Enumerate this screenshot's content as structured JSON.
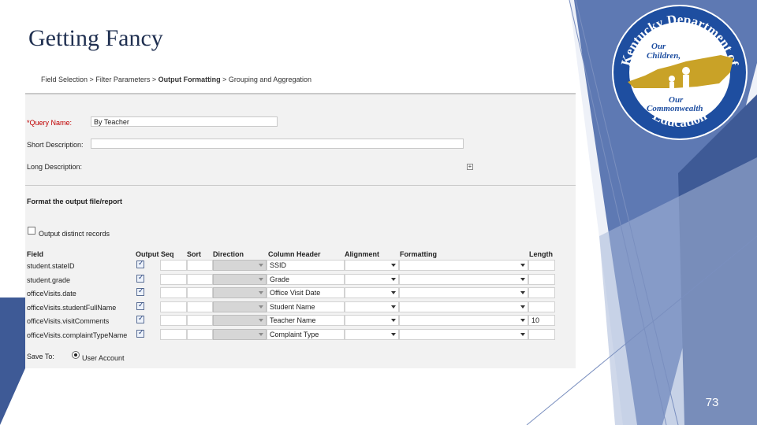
{
  "slide": {
    "title": "Getting Fancy",
    "page_number": "73",
    "colors": {
      "title": "#1f2f50",
      "accent_blue": "#5e79b3",
      "dark_blue": "#3e5a96",
      "gold": "#c9a227"
    }
  },
  "logo": {
    "seal_text_top": "Kentucky Department of",
    "seal_text_bottom": "Education",
    "center_text": [
      "Our",
      "Children,",
      "Our",
      "Commonwealth"
    ]
  },
  "screen": {
    "breadcrumbs": {
      "step1": "Field Selection >",
      "step2": "Filter Parameters >",
      "step3": "Output Formatting",
      "sep": ">",
      "step4": "Grouping and Aggregation"
    },
    "query_name": {
      "required_mark": "*",
      "label": "Query Name:",
      "value": "By Teacher"
    },
    "short_description": {
      "label": "Short Description:",
      "value": ""
    },
    "long_description": {
      "label": "Long Description:",
      "expand_symbol": "+"
    },
    "format_section": {
      "title": "Format the output file/report",
      "distinct_label": "Output distinct records",
      "distinct_checked": false
    },
    "columns": {
      "field": "Field",
      "output": "Output",
      "seq": "Seq",
      "sort": "Sort",
      "direction": "Direction",
      "column_header": "Column Header",
      "alignment": "Alignment",
      "formatting": "Formatting",
      "length": "Length"
    },
    "rows": [
      {
        "field": "student.stateID",
        "output": true,
        "seq": "",
        "sort": "",
        "direction": "",
        "header": "SSID",
        "alignment": "",
        "formatting": "",
        "length": ""
      },
      {
        "field": "student.grade",
        "output": true,
        "seq": "",
        "sort": "",
        "direction": "",
        "header": "Grade",
        "alignment": "",
        "formatting": "",
        "length": ""
      },
      {
        "field": "officeVisits.date",
        "output": true,
        "seq": "",
        "sort": "",
        "direction": "",
        "header": "Office Visit Date",
        "alignment": "",
        "formatting": "",
        "length": ""
      },
      {
        "field": "officeVisits.studentFullName",
        "output": true,
        "seq": "",
        "sort": "",
        "direction": "",
        "header": "Student Name",
        "alignment": "",
        "formatting": "",
        "length": ""
      },
      {
        "field": "officeVisits.visitComments",
        "output": true,
        "seq": "",
        "sort": "",
        "direction": "",
        "header": "Teacher Name",
        "alignment": "",
        "formatting": "",
        "length": "10"
      },
      {
        "field": "officeVisits.complaintTypeName",
        "output": true,
        "seq": "",
        "sort": "",
        "direction": "",
        "header": "Complaint Type",
        "alignment": "",
        "formatting": "",
        "length": ""
      }
    ],
    "save_to": {
      "label": "Save To:",
      "option": "User Account"
    }
  }
}
